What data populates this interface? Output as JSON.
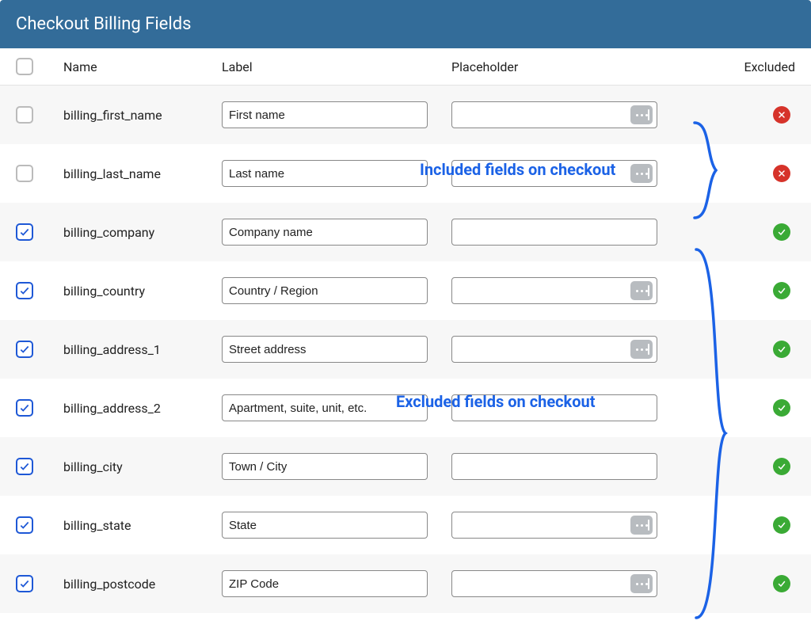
{
  "header": {
    "title": "Checkout Billing Fields"
  },
  "columns": {
    "name": "Name",
    "label": "Label",
    "placeholder": "Placeholder",
    "excluded": "Excluded"
  },
  "rows": [
    {
      "checked": false,
      "name": "billing_first_name",
      "label": "First name",
      "placeholder": "",
      "handle": true,
      "excluded": false
    },
    {
      "checked": false,
      "name": "billing_last_name",
      "label": "Last name",
      "placeholder": "",
      "handle": true,
      "excluded": false
    },
    {
      "checked": true,
      "name": "billing_company",
      "label": "Company name",
      "placeholder": "",
      "handle": false,
      "excluded": true
    },
    {
      "checked": true,
      "name": "billing_country",
      "label": "Country / Region",
      "placeholder": "",
      "handle": true,
      "excluded": true
    },
    {
      "checked": true,
      "name": "billing_address_1",
      "label": "Street address",
      "placeholder": "",
      "handle": true,
      "excluded": true
    },
    {
      "checked": true,
      "name": "billing_address_2",
      "label": "Apartment, suite, unit, etc.",
      "placeholder": "",
      "handle": false,
      "excluded": true
    },
    {
      "checked": true,
      "name": "billing_city",
      "label": "Town / City",
      "placeholder": "",
      "handle": false,
      "excluded": true
    },
    {
      "checked": true,
      "name": "billing_state",
      "label": "State",
      "placeholder": "",
      "handle": true,
      "excluded": true
    },
    {
      "checked": true,
      "name": "billing_postcode",
      "label": "ZIP Code",
      "placeholder": "",
      "handle": true,
      "excluded": true
    }
  ],
  "annotations": {
    "included": "Included fields on checkout",
    "excluded": "Excluded fields on checkout"
  }
}
